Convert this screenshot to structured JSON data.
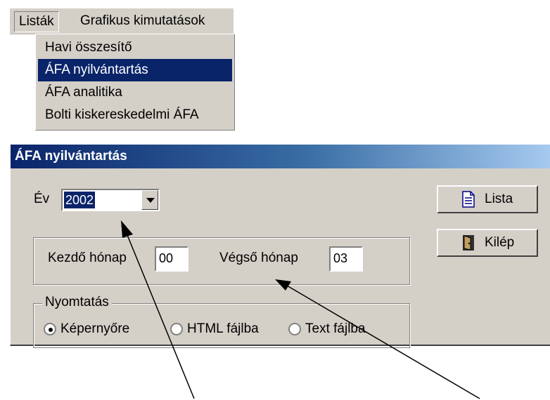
{
  "menubar": {
    "items": [
      {
        "label": "Listák"
      },
      {
        "label": "Grafikus kimutatások"
      }
    ]
  },
  "dropdown": {
    "items": [
      {
        "label": "Havi összesítő"
      },
      {
        "label": "ÁFA nyilvántartás"
      },
      {
        "label": "ÁFA analitika"
      },
      {
        "label": "Bolti kiskereskedelmi ÁFA"
      }
    ]
  },
  "window": {
    "title": "ÁFA nyilvántartás",
    "year_label": "Év",
    "year_value": "2002",
    "start_label": "Kezdő hónap",
    "start_value": "00",
    "end_label": "Végső hónap",
    "end_value": "03",
    "print_group": "Nyomtatás",
    "print_options": [
      {
        "label": "Képernyőre",
        "selected": true
      },
      {
        "label": "HTML fájlba",
        "selected": false
      },
      {
        "label": "Text fájlba",
        "selected": false
      }
    ],
    "buttons": {
      "list": "Lista",
      "exit": "Kilép"
    }
  },
  "colors": {
    "face": "#d4d0c8",
    "selection": "#0a246a",
    "titlebar_start": "#0a246a",
    "titlebar_end": "#a6caf0"
  }
}
